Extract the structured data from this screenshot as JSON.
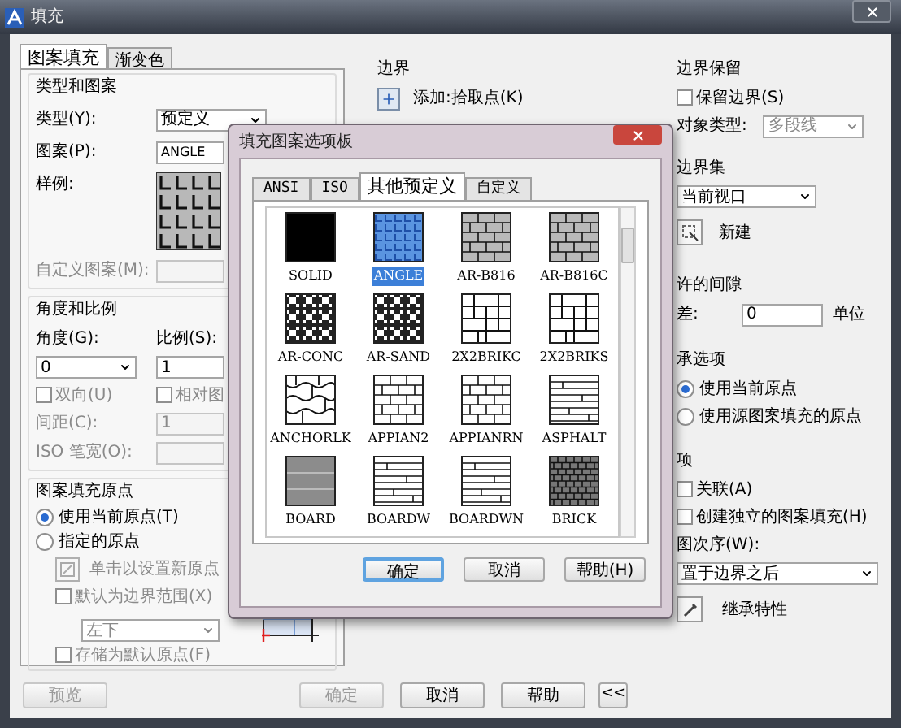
{
  "window": {
    "title": "填充"
  },
  "tabs": [
    {
      "label": "图案填充",
      "selected": true
    },
    {
      "label": "渐变色",
      "selected": false
    }
  ],
  "type_and_pattern": {
    "title": "类型和图案",
    "type_label": "类型(Y):",
    "type_value": "预定义",
    "pattern_label": "图案(P):",
    "pattern_value": "ANGLE",
    "sample_label": "样例:",
    "custom_label": "自定义图案(M):"
  },
  "angle_scale": {
    "title": "角度和比例",
    "angle_label": "角度(G):",
    "angle_value": "0",
    "scale_label": "比例(S):",
    "scale_value": "1",
    "double": {
      "label": "双向(U)",
      "checked": false
    },
    "relative": {
      "label": "相对图",
      "checked": false
    },
    "spacing_label": "间距(C):",
    "spacing_value": "1",
    "iso_label": "ISO 笔宽(O):"
  },
  "origin": {
    "title": "图案填充原点",
    "options": [
      {
        "label": "使用当前原点(T)",
        "selected": true
      },
      {
        "label": "指定的原点",
        "selected": false
      }
    ],
    "click_label": "单击以设置新原点",
    "default_extent": {
      "label": "默认为边界范围(X)",
      "checked": false
    },
    "position_value": "左下",
    "store_default": {
      "label": "存储为默认原点(F)",
      "checked": false
    }
  },
  "boundary": {
    "title": "边界",
    "add_pick": "添加:拾取点(K)"
  },
  "retain": {
    "title": "边界保留",
    "retain_box": {
      "label": "保留边界(S)",
      "checked": false
    },
    "object_type_label": "对象类型:",
    "object_type_value": "多段线"
  },
  "boundary_set": {
    "title": "边界集",
    "value": "当前视口",
    "new_label": "新建"
  },
  "gap": {
    "title": "许的间隙",
    "tolerance_label": "差:",
    "tolerance_value": "0",
    "unit": "单位"
  },
  "inherit_options": {
    "title": "承选项",
    "options": [
      {
        "label": "使用当前原点",
        "selected": true
      },
      {
        "label": "使用源图案填充的原点",
        "selected": false
      }
    ]
  },
  "options": {
    "title": "项",
    "checks": [
      {
        "label": "关联(A)",
        "checked": false
      },
      {
        "label": "创建独立的图案填充(H)",
        "checked": false
      }
    ],
    "draw_order_label": "图次序(W):",
    "draw_order_value": "置于边界之后"
  },
  "inherit_button": "继承特性",
  "buttons": [
    {
      "label": "预览",
      "disabled": true
    },
    {
      "label": "确定",
      "disabled": true
    },
    {
      "label": "取消",
      "disabled": false
    },
    {
      "label": "帮助",
      "disabled": false
    },
    {
      "label": "<<",
      "disabled": false
    }
  ],
  "palette": {
    "title": "填充图案选项板",
    "tabs": [
      {
        "label": "ANSI",
        "selected": false
      },
      {
        "label": "ISO",
        "selected": false
      },
      {
        "label": "其他预定义",
        "selected": true
      },
      {
        "label": "自定义",
        "selected": false
      }
    ],
    "patterns": [
      {
        "name": "SOLID",
        "kind": "solid",
        "selected": false
      },
      {
        "name": "ANGLE",
        "kind": "angle",
        "selected": true
      },
      {
        "name": "AR-B816",
        "kind": "brick",
        "selected": false
      },
      {
        "name": "AR-B816C",
        "kind": "brick",
        "selected": false
      },
      {
        "name": "AR-CONC",
        "kind": "noise",
        "selected": false
      },
      {
        "name": "AR-SAND",
        "kind": "noise",
        "selected": false
      },
      {
        "name": "2X2BRIKC",
        "kind": "block",
        "selected": false
      },
      {
        "name": "2X2BRIKS",
        "kind": "block",
        "selected": false
      },
      {
        "name": "ANCHORLK",
        "kind": "stone",
        "selected": false
      },
      {
        "name": "APPIAN2",
        "kind": "openbrick",
        "selected": false
      },
      {
        "name": "APPIANRN",
        "kind": "openbrick",
        "selected": false
      },
      {
        "name": "ASPHALT",
        "kind": "lines",
        "selected": false
      },
      {
        "name": "BOARD",
        "kind": "board",
        "selected": false
      },
      {
        "name": "BOARDW",
        "kind": "lines",
        "selected": false
      },
      {
        "name": "BOARDWN",
        "kind": "lines",
        "selected": false
      },
      {
        "name": "BRICK",
        "kind": "smallbrick",
        "selected": false
      }
    ],
    "buttons": [
      {
        "label": "确定",
        "default": true
      },
      {
        "label": "取消",
        "default": false
      },
      {
        "label": "帮助(H)",
        "default": false
      }
    ]
  }
}
